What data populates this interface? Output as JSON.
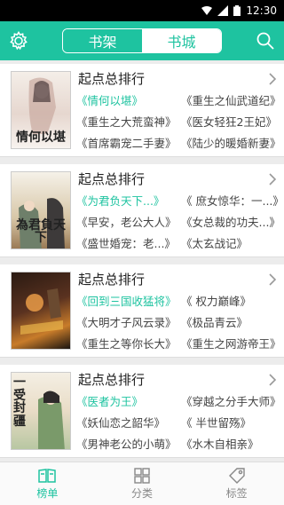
{
  "status_bar": {
    "time": "12:30"
  },
  "header": {
    "tabs": [
      {
        "label": "书架",
        "active": false
      },
      {
        "label": "书城",
        "active": true
      }
    ],
    "settings_icon": "gear-icon",
    "search_icon": "search-icon"
  },
  "accent_color": "#1ec3a0",
  "rankings": [
    {
      "title": "起点总排行",
      "cover_text": "情何以堪",
      "books": [
        "《情何以堪》",
        "《重生之仙武道纪》",
        "《重生之大荒蛮神》",
        "《医女轻狂2王妃》",
        "《首席霸宠二手妻》",
        "《陆少的暖婚新妻》"
      ]
    },
    {
      "title": "起点总排行",
      "cover_text": "為君負天下",
      "books": [
        "《为君负天下...》",
        "《 庶女惊华：一...》",
        "《早安，老公大人》",
        "《女总裁的功夫...》",
        "《盛世婚宠：老...》",
        "《太玄战记》"
      ]
    },
    {
      "title": "起点总排行",
      "cover_text": "",
      "books": [
        "《回到三国收猛将》",
        "《 权力巅峰》",
        "《大明才子风云录》",
        "《极品青云》",
        "《重生之等你长大》",
        "《重生之网游帝王》"
      ]
    },
    {
      "title": "起点总排行",
      "cover_text": "一受封疆",
      "books": [
        "《医者为王》",
        "《穿越之分手大师》",
        "《妖仙恋之韶华》",
        "《 半世留殇》",
        "《男神老公的小萌》",
        "《水木自相亲》"
      ]
    }
  ],
  "tab_bar": {
    "items": [
      {
        "label": "榜单",
        "icon": "book-open-icon",
        "active": true
      },
      {
        "label": "分类",
        "icon": "grid-icon",
        "active": false
      },
      {
        "label": "标签",
        "icon": "tag-icon",
        "active": false
      }
    ]
  }
}
